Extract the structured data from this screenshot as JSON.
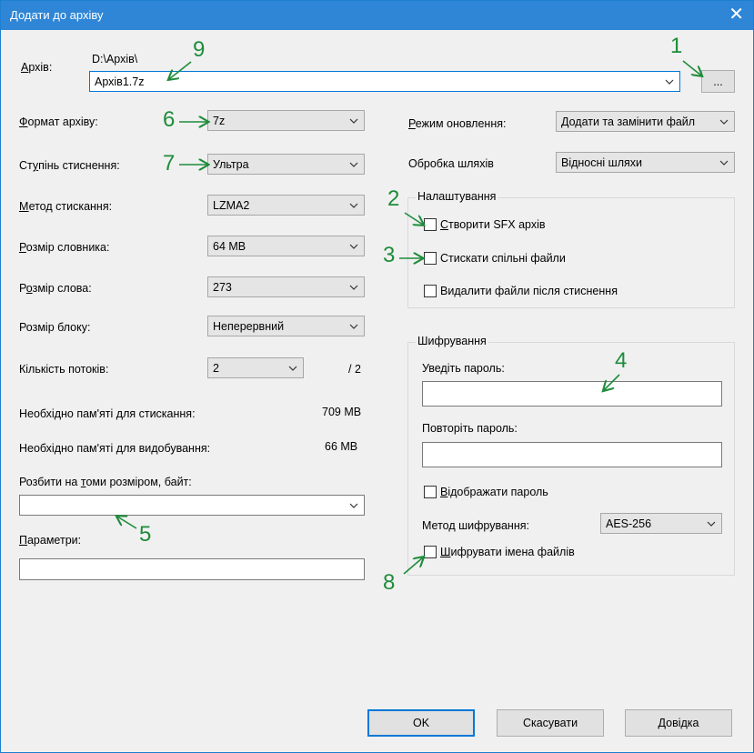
{
  "window": {
    "title": "Додати до архіву",
    "close": "✕"
  },
  "archive": {
    "label": "Архів:",
    "path": "D:\\Архів\\",
    "name": "Архів1.7z",
    "browse": "..."
  },
  "left": {
    "format_label": "Формат архіву:",
    "format_value": "7z",
    "level_label": "Ступінь стиснення:",
    "level_value": "Ультра",
    "method_label": "Метод стискання:",
    "method_value": "LZMA2",
    "dict_label": "Розмір словника:",
    "dict_value": "64 MB",
    "word_label": "Розмір слова:",
    "word_value": "273",
    "block_label": "Розмір блоку:",
    "block_value": "Неперервний",
    "threads_label": "Кількість потоків:",
    "threads_value": "2",
    "threads_max": "/ 2",
    "mem_comp_label": "Необхідно пам'яті для стискання:",
    "mem_comp_value": "709 MB",
    "mem_decomp_label": "Необхідно пам'яті для видобування:",
    "mem_decomp_value": "66 MB",
    "split_label": "Розбити на томи розміром, байт:",
    "split_value": "",
    "params_label": "Параметри:",
    "params_value": ""
  },
  "right": {
    "update_label": "Режим оновлення:",
    "update_value": "Додати та замінити файл",
    "paths_label": "Обробка шляхів",
    "paths_value": "Відносні шляхи",
    "options": {
      "title": "Налаштування",
      "sfx": "Створити SFX архів",
      "shared": "Стискати спільні файли",
      "delete": "Видалити файли після стиснення"
    },
    "encryption": {
      "title": "Шифрування",
      "enter_pw": "Уведіть пароль:",
      "repeat_pw": "Повторіть пароль:",
      "show_pw": "Відображати пароль",
      "method_label": "Метод шифрування:",
      "method_value": "AES-256",
      "encrypt_names": "Шифрувати імена файлів"
    }
  },
  "buttons": {
    "ok": "OK",
    "cancel": "Скасувати",
    "help": "Довідка"
  },
  "annotations": {
    "a1": "1",
    "a2": "2",
    "a3": "3",
    "a4": "4",
    "a5": "5",
    "a6": "6",
    "a7": "7",
    "a8": "8",
    "a9": "9"
  },
  "colors": {
    "title_bar": "#2f86d6",
    "annotation": "#1e8c3a",
    "dialog_bg": "#f0f0f0",
    "ok_border": "#0078d7"
  }
}
